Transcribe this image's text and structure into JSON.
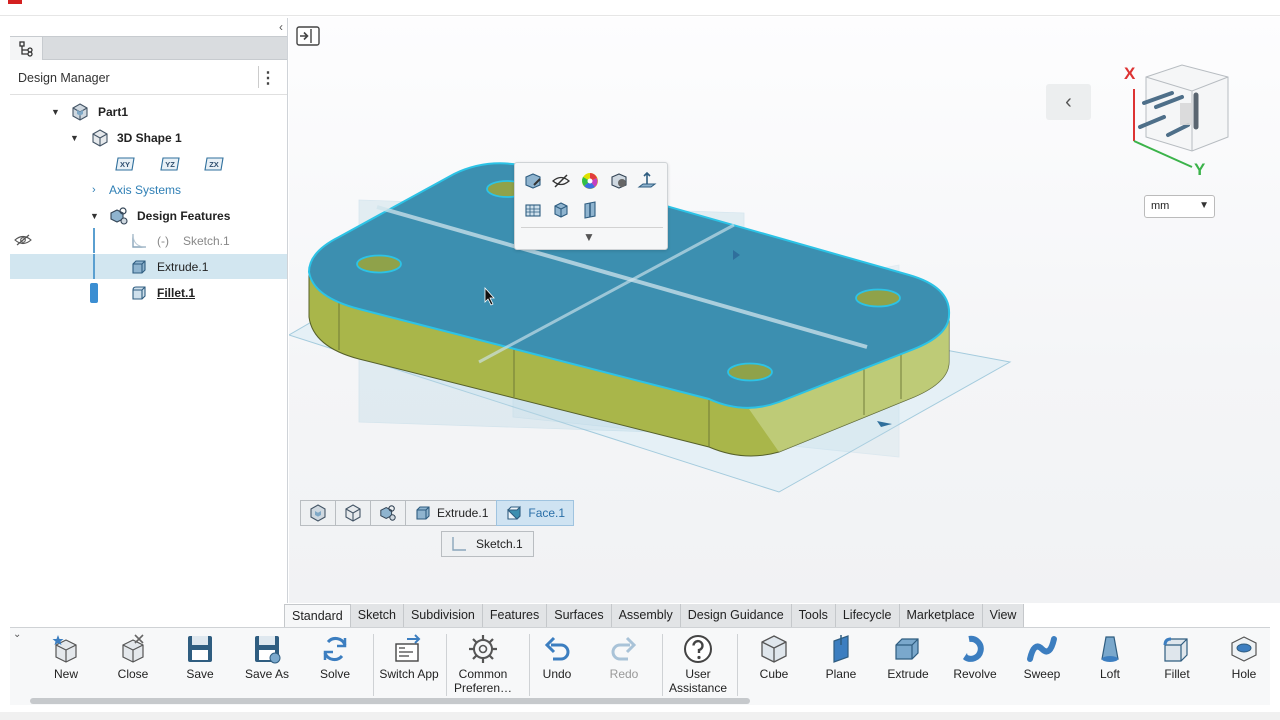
{
  "design_manager": {
    "title": "Design Manager",
    "tree": {
      "part": "Part1",
      "shape": "3D Shape 1",
      "planes": [
        "XY",
        "YZ",
        "ZX"
      ],
      "axis_systems": "Axis Systems",
      "design_features": "Design Features",
      "sketch": "Sketch.1",
      "sketch_prefix": "(-)",
      "extrude": "Extrude.1",
      "fillet": "Fillet.1"
    }
  },
  "viewport": {
    "units": "mm",
    "compass": {
      "x_label": "X",
      "y_label": "Y"
    },
    "colors": {
      "body": "#a9b64a",
      "selected_face": "#3c8fb0",
      "edge_highlight": "#2cc3e6",
      "plane": "#bcdbe8"
    }
  },
  "breadcrumb": {
    "items": [
      "Extrude.1",
      "Face.1"
    ],
    "sub": "Sketch.1"
  },
  "ribbon": {
    "tabs": [
      "Standard",
      "Sketch",
      "Subdivision",
      "Features",
      "Surfaces",
      "Assembly",
      "Design Guidance",
      "Tools",
      "Lifecycle",
      "Marketplace",
      "View"
    ],
    "active_tab": "Standard",
    "buttons": {
      "new": "New",
      "close": "Close",
      "save": "Save",
      "save_as": "Save As",
      "solve": "Solve",
      "switch_app": "Switch App",
      "common_prefs_1": "Common",
      "common_prefs_2": "Preferen…",
      "undo": "Undo",
      "redo": "Redo",
      "user_assist_1": "User",
      "user_assist_2": "Assistance",
      "cube": "Cube",
      "plane": "Plane",
      "extrude": "Extrude",
      "revolve": "Revolve",
      "sweep": "Sweep",
      "loft": "Loft",
      "fillet": "Fillet",
      "hole": "Hole"
    }
  }
}
